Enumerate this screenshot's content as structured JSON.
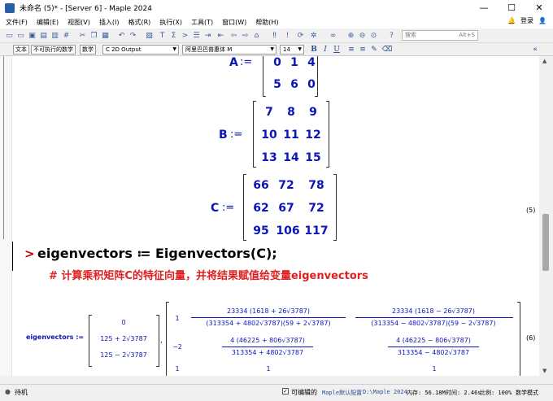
{
  "window": {
    "title": "未命名 (5)* - [Server 6] - Maple 2024",
    "minimize": "—",
    "maximize": "☐",
    "close": "✕"
  },
  "menubar": {
    "items": [
      "文件(F)",
      "编辑(E)",
      "视图(V)",
      "插入(I)",
      "格式(R)",
      "执行(X)",
      "工具(T)",
      "窗口(W)",
      "帮助(H)"
    ],
    "login_label": "登录"
  },
  "toolbar": {
    "search_placeholder": "搜索",
    "search_shortcut": "Alt+S"
  },
  "context_bar": {
    "text_mode": "文本",
    "nonexec_mode": "不可执行的数学",
    "math_mode": "数学",
    "style_value": "C  2D Output",
    "font_value": "阿里巴巴普惠体 M",
    "size_value": "14",
    "bold": "B",
    "italic": "I",
    "underline": "U"
  },
  "document": {
    "matrix_A": {
      "label": "A",
      "assign": ":=",
      "rows": [
        [
          "0",
          "1",
          "4"
        ],
        [
          "5",
          "6",
          "0"
        ]
      ]
    },
    "matrix_B": {
      "label": "B",
      "assign": ":=",
      "rows": [
        [
          "7",
          "8",
          "9"
        ],
        [
          "10",
          "11",
          "12"
        ],
        [
          "13",
          "14",
          "15"
        ]
      ]
    },
    "matrix_C": {
      "label": "C",
      "assign": ":=",
      "rows": [
        [
          "66",
          "72",
          "78"
        ],
        [
          "62",
          "67",
          "72"
        ],
        [
          "95",
          "106",
          "117"
        ]
      ]
    },
    "eq5": "(5)",
    "prompt": ">",
    "command": "eigenvectors ≔ Eigenvectors(C);",
    "comment": "# 计算乘积矩阵C的特征向量，并将结果赋值给变量eigenvectors",
    "result_label": "eigenvectors :=",
    "eigenvalues": [
      "0",
      "125 + 2√3787",
      "125 − 2√3787"
    ],
    "vec_row1": [
      "1",
      "23334 (1618 + 26√3787)",
      "(313354 + 4802√3787)(59 + 2√3787)",
      "23334 (1618 − 26√3787)",
      "(313354 − 4802√3787)(59 − 2√3787)"
    ],
    "vec_row2": [
      "−2",
      "4 (46225 + 806√3787)",
      "313354 + 4802√3787",
      "4 (46225 − 806√3787)",
      "313354 − 4802√3787"
    ],
    "vec_row3": [
      "1",
      "1",
      "1"
    ],
    "comma": ",",
    "eq6": "(6)"
  },
  "statusbar": {
    "ready": "待机",
    "editable_label": "可编辑的",
    "maple_default": "Maple默认配置",
    "path": "D:\\Maple 2024",
    "memory": "内存: 56.18M",
    "time": "时间: 2.46s",
    "zoom": "比例: 100%",
    "mode": "数学模式"
  },
  "colors": {
    "math_blue": "#0b15b8",
    "comment_red": "#e02020",
    "prompt_red": "#c00000"
  }
}
